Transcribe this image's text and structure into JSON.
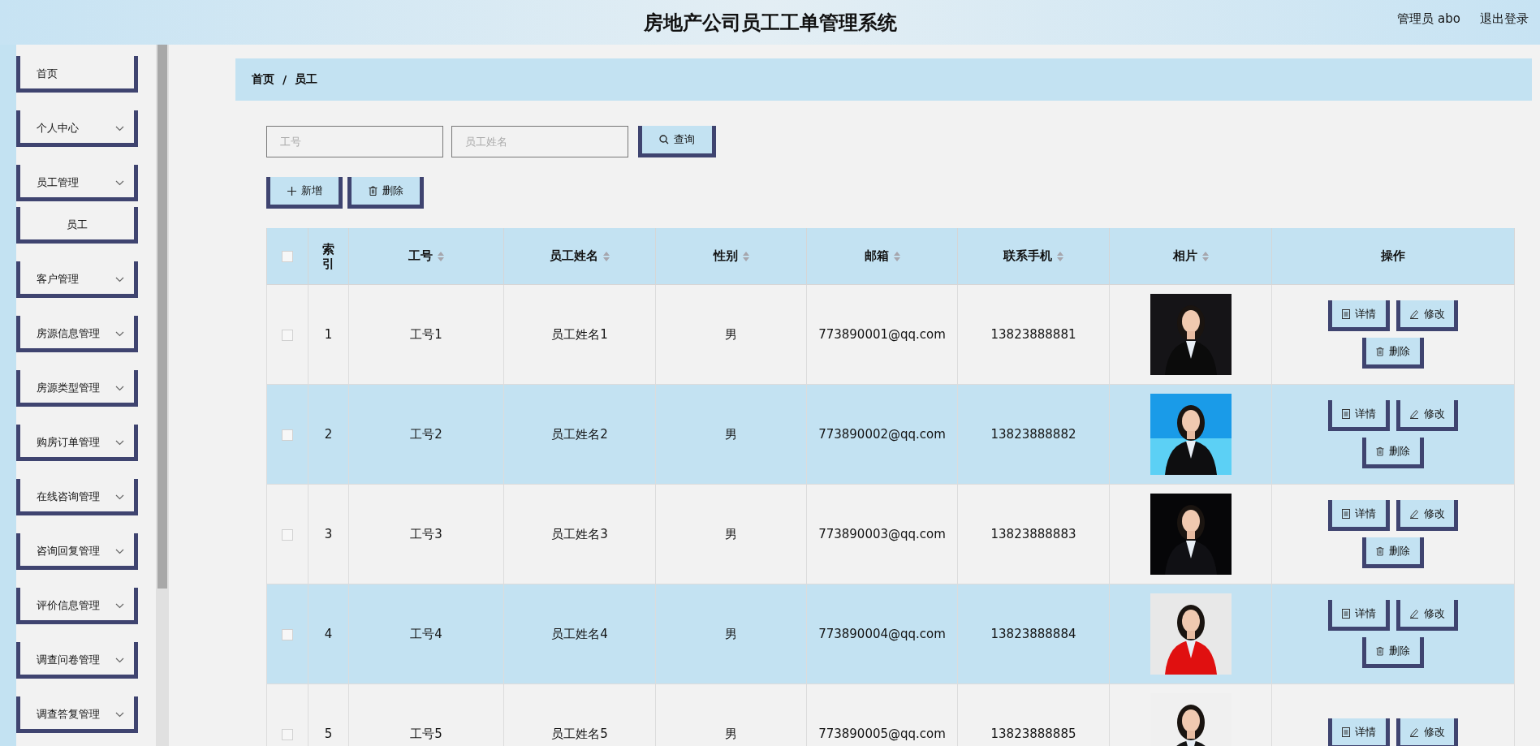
{
  "header": {
    "title": "房地产公司员工工单管理系统",
    "user": "管理员 abo",
    "logout": "退出登录"
  },
  "sidebar": {
    "items": [
      {
        "label": "首页",
        "kind": "link"
      },
      {
        "label": "个人中心",
        "kind": "menu"
      },
      {
        "label": "员工管理",
        "kind": "menu",
        "children": [
          {
            "label": "员工"
          }
        ]
      },
      {
        "label": "客户管理",
        "kind": "menu"
      },
      {
        "label": "房源信息管理",
        "kind": "menu"
      },
      {
        "label": "房源类型管理",
        "kind": "menu"
      },
      {
        "label": "购房订单管理",
        "kind": "menu"
      },
      {
        "label": "在线咨询管理",
        "kind": "menu"
      },
      {
        "label": "咨询回复管理",
        "kind": "menu"
      },
      {
        "label": "评价信息管理",
        "kind": "menu"
      },
      {
        "label": "调查问卷管理",
        "kind": "menu"
      },
      {
        "label": "调查答复管理",
        "kind": "menu"
      }
    ]
  },
  "breadcrumb": {
    "items": [
      "首页",
      "员工"
    ],
    "separator": "/"
  },
  "search": {
    "fields": [
      {
        "placeholder": "工号"
      },
      {
        "placeholder": "员工姓名"
      }
    ],
    "button": "查询"
  },
  "actions": [
    {
      "label": "新增",
      "kind": "add"
    },
    {
      "label": "删除",
      "kind": "delete"
    }
  ],
  "table": {
    "select_all": {
      "checked": false
    },
    "columns": [
      {
        "label": "索引",
        "sortable": false
      },
      {
        "label": "工号",
        "sortable": true
      },
      {
        "label": "员工姓名",
        "sortable": true
      },
      {
        "label": "性别",
        "sortable": true
      },
      {
        "label": "邮箱",
        "sortable": true
      },
      {
        "label": "联系手机",
        "sortable": true
      },
      {
        "label": "相片",
        "sortable": true
      },
      {
        "label": "操作",
        "sortable": false
      }
    ],
    "rows": [
      {
        "checked": false,
        "index": "1",
        "id": "工号1",
        "name": "员工姓名1",
        "gender": "男",
        "email": "773890001@qq.com",
        "phone": "13823888881",
        "photo": {
          "kind": "picture"
        },
        "actions": [
          {
            "label": "详情",
            "kind": "detail"
          },
          {
            "label": "修改",
            "kind": "edit"
          },
          {
            "label": "删除",
            "kind": "delete"
          }
        ]
      },
      {
        "checked": false,
        "index": "2",
        "id": "工号2",
        "name": "员工姓名2",
        "gender": "男",
        "email": "773890002@qq.com",
        "phone": "13823888882",
        "photo": {
          "kind": "picture"
        },
        "actions": [
          {
            "label": "详情",
            "kind": "detail"
          },
          {
            "label": "修改",
            "kind": "edit"
          },
          {
            "label": "删除",
            "kind": "delete"
          }
        ]
      },
      {
        "checked": false,
        "index": "3",
        "id": "工号3",
        "name": "员工姓名3",
        "gender": "男",
        "email": "773890003@qq.com",
        "phone": "13823888883",
        "photo": {
          "kind": "picture"
        },
        "actions": [
          {
            "label": "详情",
            "kind": "detail"
          },
          {
            "label": "修改",
            "kind": "edit"
          },
          {
            "label": "删除",
            "kind": "delete"
          }
        ]
      },
      {
        "checked": false,
        "index": "4",
        "id": "工号4",
        "name": "员工姓名4",
        "gender": "男",
        "email": "773890004@qq.com",
        "phone": "13823888884",
        "photo": {
          "kind": "picture"
        },
        "actions": [
          {
            "label": "详情",
            "kind": "detail"
          },
          {
            "label": "修改",
            "kind": "edit"
          },
          {
            "label": "删除",
            "kind": "delete"
          }
        ]
      },
      {
        "checked": false,
        "index": "5",
        "id": "工号5",
        "name": "员工姓名5",
        "gender": "男",
        "email": "773890005@qq.com",
        "phone": "13823888885",
        "photo": {
          "kind": "picture"
        },
        "actions": [
          {
            "label": "详情",
            "kind": "detail"
          },
          {
            "label": "修改",
            "kind": "edit"
          }
        ]
      }
    ]
  }
}
